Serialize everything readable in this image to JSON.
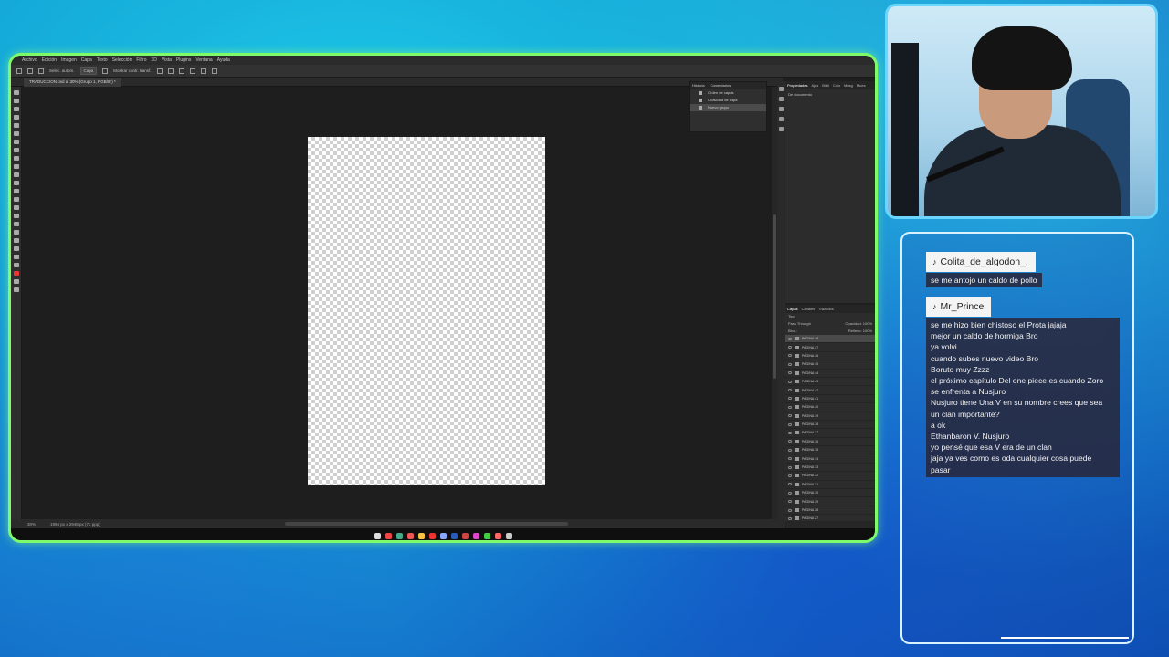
{
  "photoshop": {
    "menu": [
      "Archivo",
      "Edición",
      "Imagen",
      "Capa",
      "Texto",
      "Selección",
      "Filtro",
      "3D",
      "Vista",
      "Plugins",
      "Ventana",
      "Ayuda"
    ],
    "options": {
      "autoselect": "Selec. autom.",
      "target": "Capa",
      "transform": "Mostrar contr. transf."
    },
    "doc_tab": "TRADUCCION.psd al 30% (Grupo 1, RGB/8*) *",
    "status": {
      "zoom": "30%",
      "dimensions": "1994 px x 2948 px (72 ppp)"
    },
    "history": {
      "tabs": [
        "Historia",
        "Comentarios"
      ],
      "items": [
        "Orden de capas",
        "Opacidad de capa",
        "Nuevo grupo"
      ]
    },
    "properties": {
      "tabs": [
        "Propiedades",
        "Ajus",
        "Bibli",
        "Colo",
        "Musg",
        "Mues"
      ],
      "subtitle": "De documento"
    },
    "layers": {
      "tabs": [
        "Capas",
        "Canales",
        "Trazados"
      ],
      "filter": "Tipo",
      "blend": "Pass Through",
      "opacity": "Opacidad: 100%",
      "lock": "Bloq.:",
      "fill": "Relleno: 100%",
      "rows": [
        "PAGINA 48",
        "PAGINA 47",
        "PAGINA 46",
        "PAGINA 45",
        "PAGINA 44",
        "PAGINA 43",
        "PAGINA 42",
        "PAGINA 41",
        "PAGINA 40",
        "PAGINA 39",
        "PAGINA 38",
        "PAGINA 37",
        "PAGINA 36",
        "PAGINA 35",
        "PAGINA 34",
        "PAGINA 33",
        "PAGINA 32",
        "PAGINA 31",
        "PAGINA 30",
        "PAGINA 29",
        "PAGINA 28",
        "PAGINA 27"
      ]
    }
  },
  "chat": {
    "messages": [
      {
        "user": "Colita_de_algodon_.",
        "lines": [
          "se me antojo un caldo de pollo"
        ]
      },
      {
        "user": "Mr_Prince",
        "lines": [
          "se me hizo bien chistoso el Prota jajaja",
          "mejor un caldo de hormiga Bro",
          "ya volvi",
          "cuando subes nuevo video Bro",
          "Boruto muy Zzzz",
          "el próximo capítulo Del one piece es cuando Zoro",
          "se enfrenta a Nusjuro",
          "Nusjuro tiene Una V en su nombre crees que sea",
          "un clan importante?",
          "a ok",
          "Ethanbaron V. Nusjuro",
          "yo pensé que esa V era de un clan",
          "jaja ya ves como es oda cualquier cosa puede",
          "pasar"
        ]
      }
    ]
  },
  "colors": {
    "frame_border": "#7dfb6a",
    "cam_border": "#6ad6ff",
    "chat_border": "#d8f2ff"
  }
}
